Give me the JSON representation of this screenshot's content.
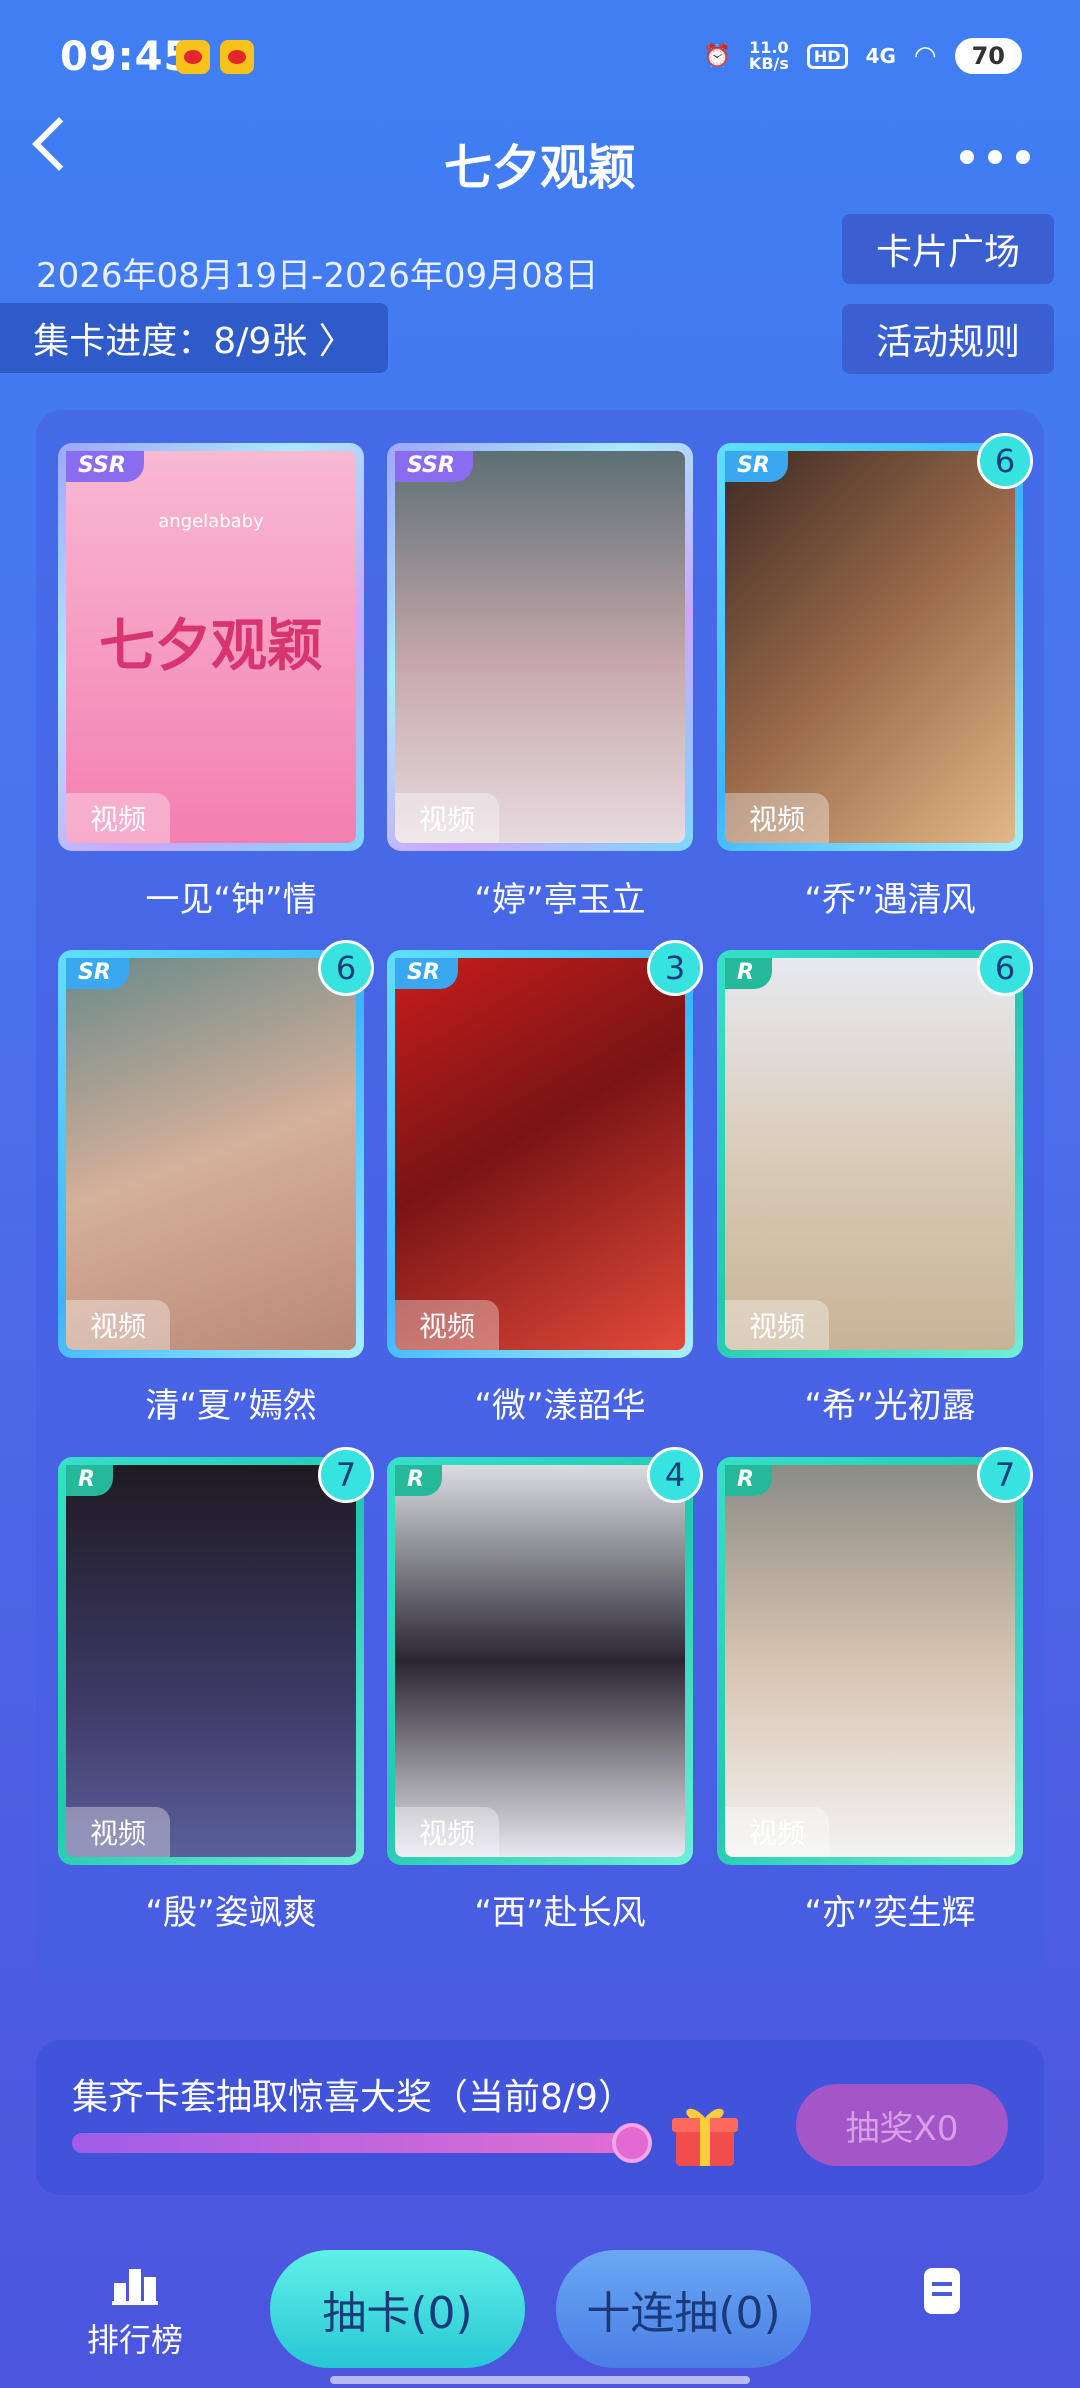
{
  "status_bar": {
    "time": "09:45",
    "network_speed": "11.0",
    "network_speed_unit": "KB/s",
    "hd": "HD",
    "signal": "4G",
    "battery": "70"
  },
  "header": {
    "title": "七夕观颖",
    "date_range": "2026年08月19日-2026年09月08日",
    "progress": "集卡进度：8/9张 〉",
    "plaza_button": "卡片广场",
    "rules_button": "活动规则"
  },
  "cards": [
    {
      "rarity": "SSR",
      "count": "",
      "tag": "视频",
      "name": "一见“钟”情",
      "poster_title": "七夕观颖",
      "poster_sub": "angelababy"
    },
    {
      "rarity": "SSR",
      "count": "",
      "tag": "视频",
      "name": "“婷”亭玉立"
    },
    {
      "rarity": "SR",
      "count": "6",
      "tag": "视频",
      "name": "“乔”遇清风"
    },
    {
      "rarity": "SR",
      "count": "6",
      "tag": "视频",
      "name": "清“夏”嫣然"
    },
    {
      "rarity": "SR",
      "count": "3",
      "tag": "视频",
      "name": "“微”漾韶华"
    },
    {
      "rarity": "R",
      "count": "6",
      "tag": "视频",
      "name": "“希”光初露"
    },
    {
      "rarity": "R",
      "count": "7",
      "tag": "视频",
      "name": "“殷”姿飒爽"
    },
    {
      "rarity": "R",
      "count": "4",
      "tag": "视频",
      "name": "“西”赴长风"
    },
    {
      "rarity": "R",
      "count": "7",
      "tag": "视频",
      "name": "“亦”奕生辉"
    }
  ],
  "prize": {
    "text": "集齐卡套抽取惊喜大奖（当前8/9）",
    "progress_fraction": 0.889,
    "lottery_button": "抽奖X0"
  },
  "bottom_bar": {
    "rank_label": "排行榜",
    "draw_one": "抽卡(0)",
    "draw_ten": "十连抽(0)"
  },
  "colors": {
    "background": "#4a74ee",
    "ssr_frame": "#a9b4ff",
    "sr_frame": "#3ab6ff",
    "r_frame": "#20c9b0",
    "badge": "#36e3e0",
    "draw_button": "#3fdde0"
  }
}
